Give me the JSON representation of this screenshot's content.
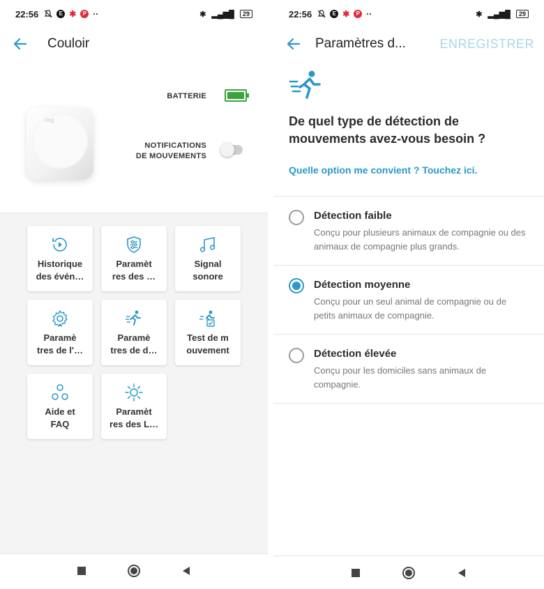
{
  "colors": {
    "accent": "#2a98c8",
    "battery_green": "#3ba33b",
    "save_disabled": "#a9d6ea",
    "tile_bg": "#f4f4f4"
  },
  "status_bar": {
    "time": "22:56",
    "battery": "29",
    "network": "4G"
  },
  "left": {
    "title": "Couloir",
    "battery_label": "BATTERIE",
    "notifications_label": "NOTIFICATIONS\nDE MOUVEMENTS",
    "notifications_enabled": false,
    "device_logo": "ring",
    "tiles": [
      {
        "label": "Historique\ndes évén…",
        "icon": "history-icon"
      },
      {
        "label": "Paramèt\nres des …",
        "icon": "shield-settings-icon"
      },
      {
        "label": "Signal\nsonore",
        "icon": "music-note-icon"
      },
      {
        "label": "Paramè\ntres de l'…",
        "icon": "gear-icon"
      },
      {
        "label": "Paramè\ntres de d…",
        "icon": "running-motion-icon"
      },
      {
        "label": "Test de m\nouvement",
        "icon": "motion-test-icon"
      },
      {
        "label": "Aide et\nFAQ",
        "icon": "help-circles-icon"
      },
      {
        "label": "Paramèt\nres des L…",
        "icon": "sun-light-icon"
      }
    ]
  },
  "right": {
    "title": "Paramètres d...",
    "save_label": "ENREGISTRER",
    "question": "De quel type de détection de mouvements avez-vous besoin ?",
    "help_link": "Quelle option me convient ? Touchez ici.",
    "selected_option": 1,
    "options": [
      {
        "title": "Détection faible",
        "description": "Conçu pour plusieurs animaux de compagnie ou des animaux de compagnie plus grands."
      },
      {
        "title": "Détection moyenne",
        "description": "Conçu pour un seul animal de compagnie ou de petits animaux de compagnie."
      },
      {
        "title": "Détection élevée",
        "description": "Conçu pour les domiciles sans animaux de compagnie."
      }
    ]
  }
}
